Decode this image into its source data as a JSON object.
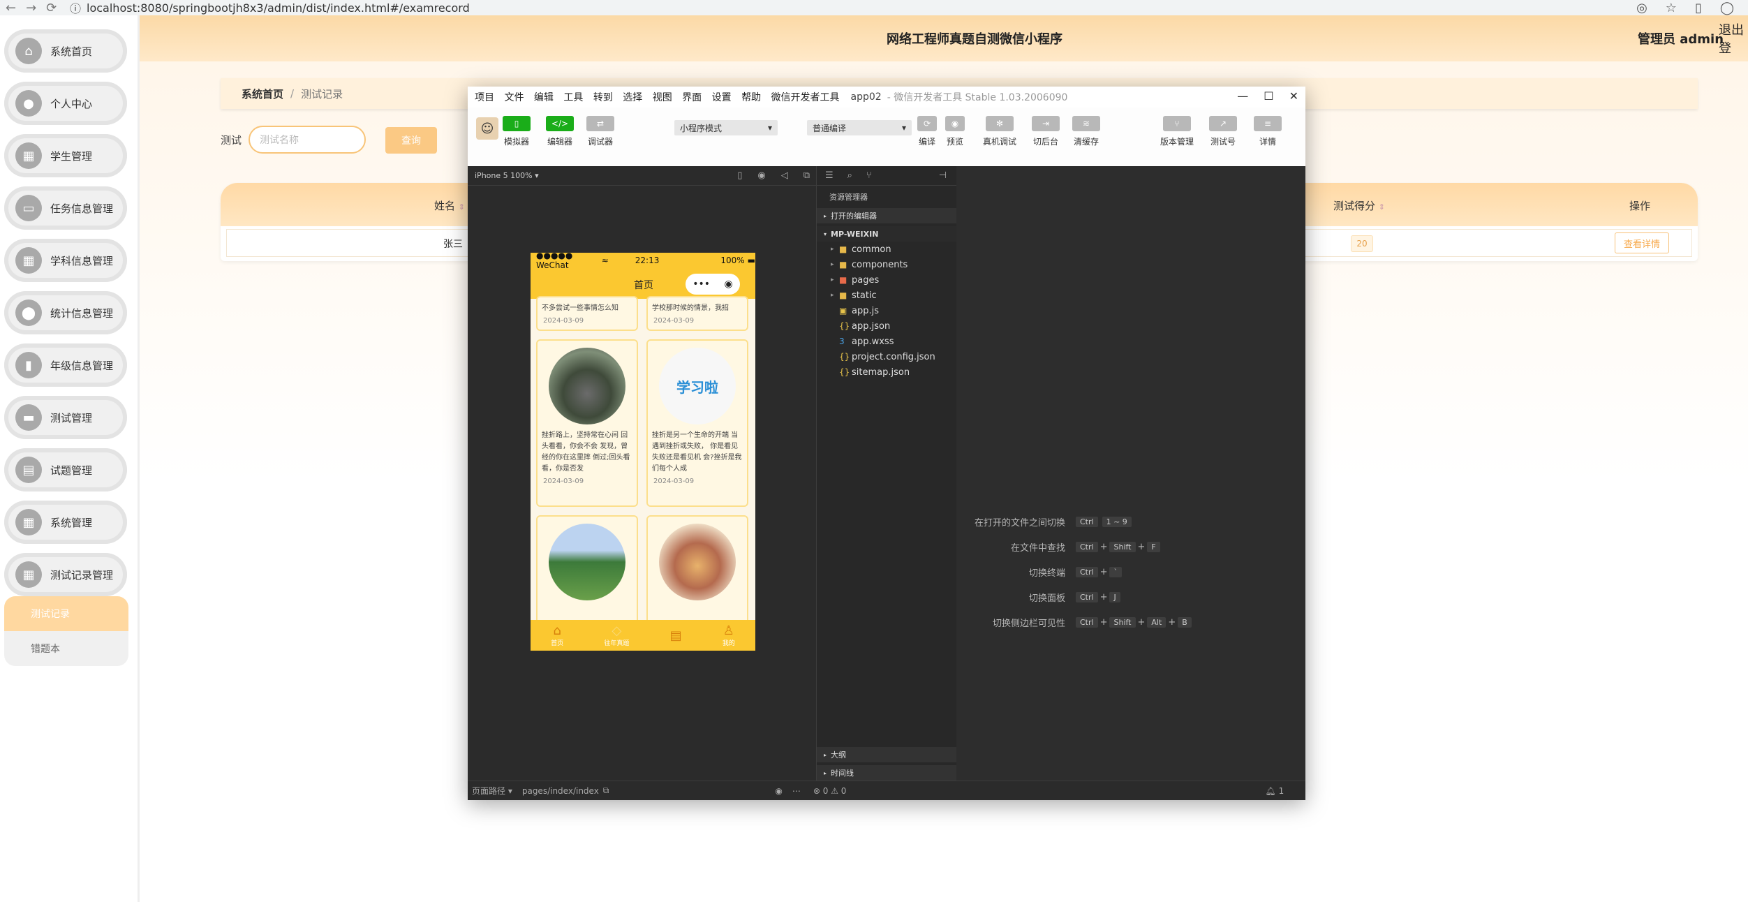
{
  "browser": {
    "url": "localhost:8080/springbootjh8x3/admin/dist/index.html#/examrecord"
  },
  "header": {
    "title": "网络工程师真题自测微信小程序",
    "user": "管理员 admin",
    "logout": "退出登"
  },
  "sidebar": {
    "items": [
      {
        "label": "系统首页",
        "icon": "home-icon"
      },
      {
        "label": "个人中心",
        "icon": "user-icon"
      },
      {
        "label": "学生管理",
        "icon": "grid-icon"
      },
      {
        "label": "任务信息管理",
        "icon": "screen-icon"
      },
      {
        "label": "学科信息管理",
        "icon": "grid-icon"
      },
      {
        "label": "统计信息管理",
        "icon": "pin-icon"
      },
      {
        "label": "年级信息管理",
        "icon": "bar-chart-icon"
      },
      {
        "label": "测试管理",
        "icon": "chat-icon"
      },
      {
        "label": "试题管理",
        "icon": "clipboard-icon"
      },
      {
        "label": "系统管理",
        "icon": "grid-icon"
      },
      {
        "label": "测试记录管理",
        "icon": "grid-icon"
      }
    ],
    "sub_active": "测试记录",
    "sub_plain": "错题本"
  },
  "breadcrumb": {
    "home": "系统首页",
    "sep": "/",
    "current": "测试记录"
  },
  "search": {
    "label": "测试",
    "placeholder": "测试名称",
    "button": "查询"
  },
  "table": {
    "col_name": "姓名",
    "col_score": "测试得分",
    "col_action": "操作",
    "sort_glyph": "⇕",
    "row": {
      "name": "张三",
      "score": "20",
      "action": "查看详情"
    }
  },
  "devtools": {
    "menu": [
      "项目",
      "文件",
      "编辑",
      "工具",
      "转到",
      "选择",
      "视图",
      "界面",
      "设置",
      "帮助",
      "微信开发者工具"
    ],
    "app": "app02",
    "version": "- 微信开发者工具 Stable 1.03.2006090",
    "toolbar": {
      "simulator": "模拟器",
      "editor": "编辑器",
      "debugger": "调试器",
      "mode": "小程序模式",
      "compile_mode": "普通编译",
      "compile": "编译",
      "preview": "预览",
      "real_debug": "真机调试",
      "background": "切后台",
      "clear_cache": "清缓存",
      "version_mgmt": "版本管理",
      "test_account": "测试号",
      "details": "详情"
    },
    "device": "iPhone 5 100% ▾",
    "phone": {
      "carrier": "●●●●● WeChat",
      "time": "22:13",
      "battery": "100%",
      "nav_title": "首页",
      "cards": [
        {
          "text": "不多尝试一些事情怎么知",
          "date": "2024-03-09"
        },
        {
          "text": "学校那时候的情景，我招",
          "date": "2024-03-09"
        },
        {
          "text": "挫折路上，坚持常在心间 回头看看，你会不会 发现，曾经的你在这里摔 倒过;回头看看，你是否发",
          "date": "2024-03-09"
        },
        {
          "text": "挫折是另一个生命的开端 当遇到挫折或失败， 你是看见失败还是看见机 会?挫折是我们每个人成",
          "date": "2024-03-09"
        }
      ],
      "logo_text": "学习啦",
      "tabs": [
        "首页",
        "往年真题",
        "",
        "我的"
      ]
    },
    "explorer": {
      "title": "资源管理器",
      "open_editors": "打开的编辑器",
      "project": "MP-WEIXIN",
      "folders": [
        "common",
        "components",
        "pages",
        "static"
      ],
      "files": [
        "app.js",
        "app.json",
        "app.wxss",
        "project.config.json",
        "sitemap.json"
      ],
      "outline": "大纲",
      "timeline": "时间线"
    },
    "hints": [
      {
        "label": "在打开的文件之间切换",
        "keys": [
          "Ctrl",
          "1 ~ 9"
        ]
      },
      {
        "label": "在文件中查找",
        "keys": [
          "Ctrl",
          "Shift",
          "F"
        ]
      },
      {
        "label": "切换终端",
        "keys": [
          "Ctrl",
          "`"
        ]
      },
      {
        "label": "切换面板",
        "keys": [
          "Ctrl",
          "J"
        ]
      },
      {
        "label": "切换侧边栏可见性",
        "keys": [
          "Ctrl",
          "Shift",
          "Alt",
          "B"
        ]
      }
    ],
    "footer": {
      "path_label": "页面路径 ▾",
      "path": "pages/index/index",
      "status": "⊗ 0 ⚠ 0",
      "bell_count": "1"
    }
  }
}
